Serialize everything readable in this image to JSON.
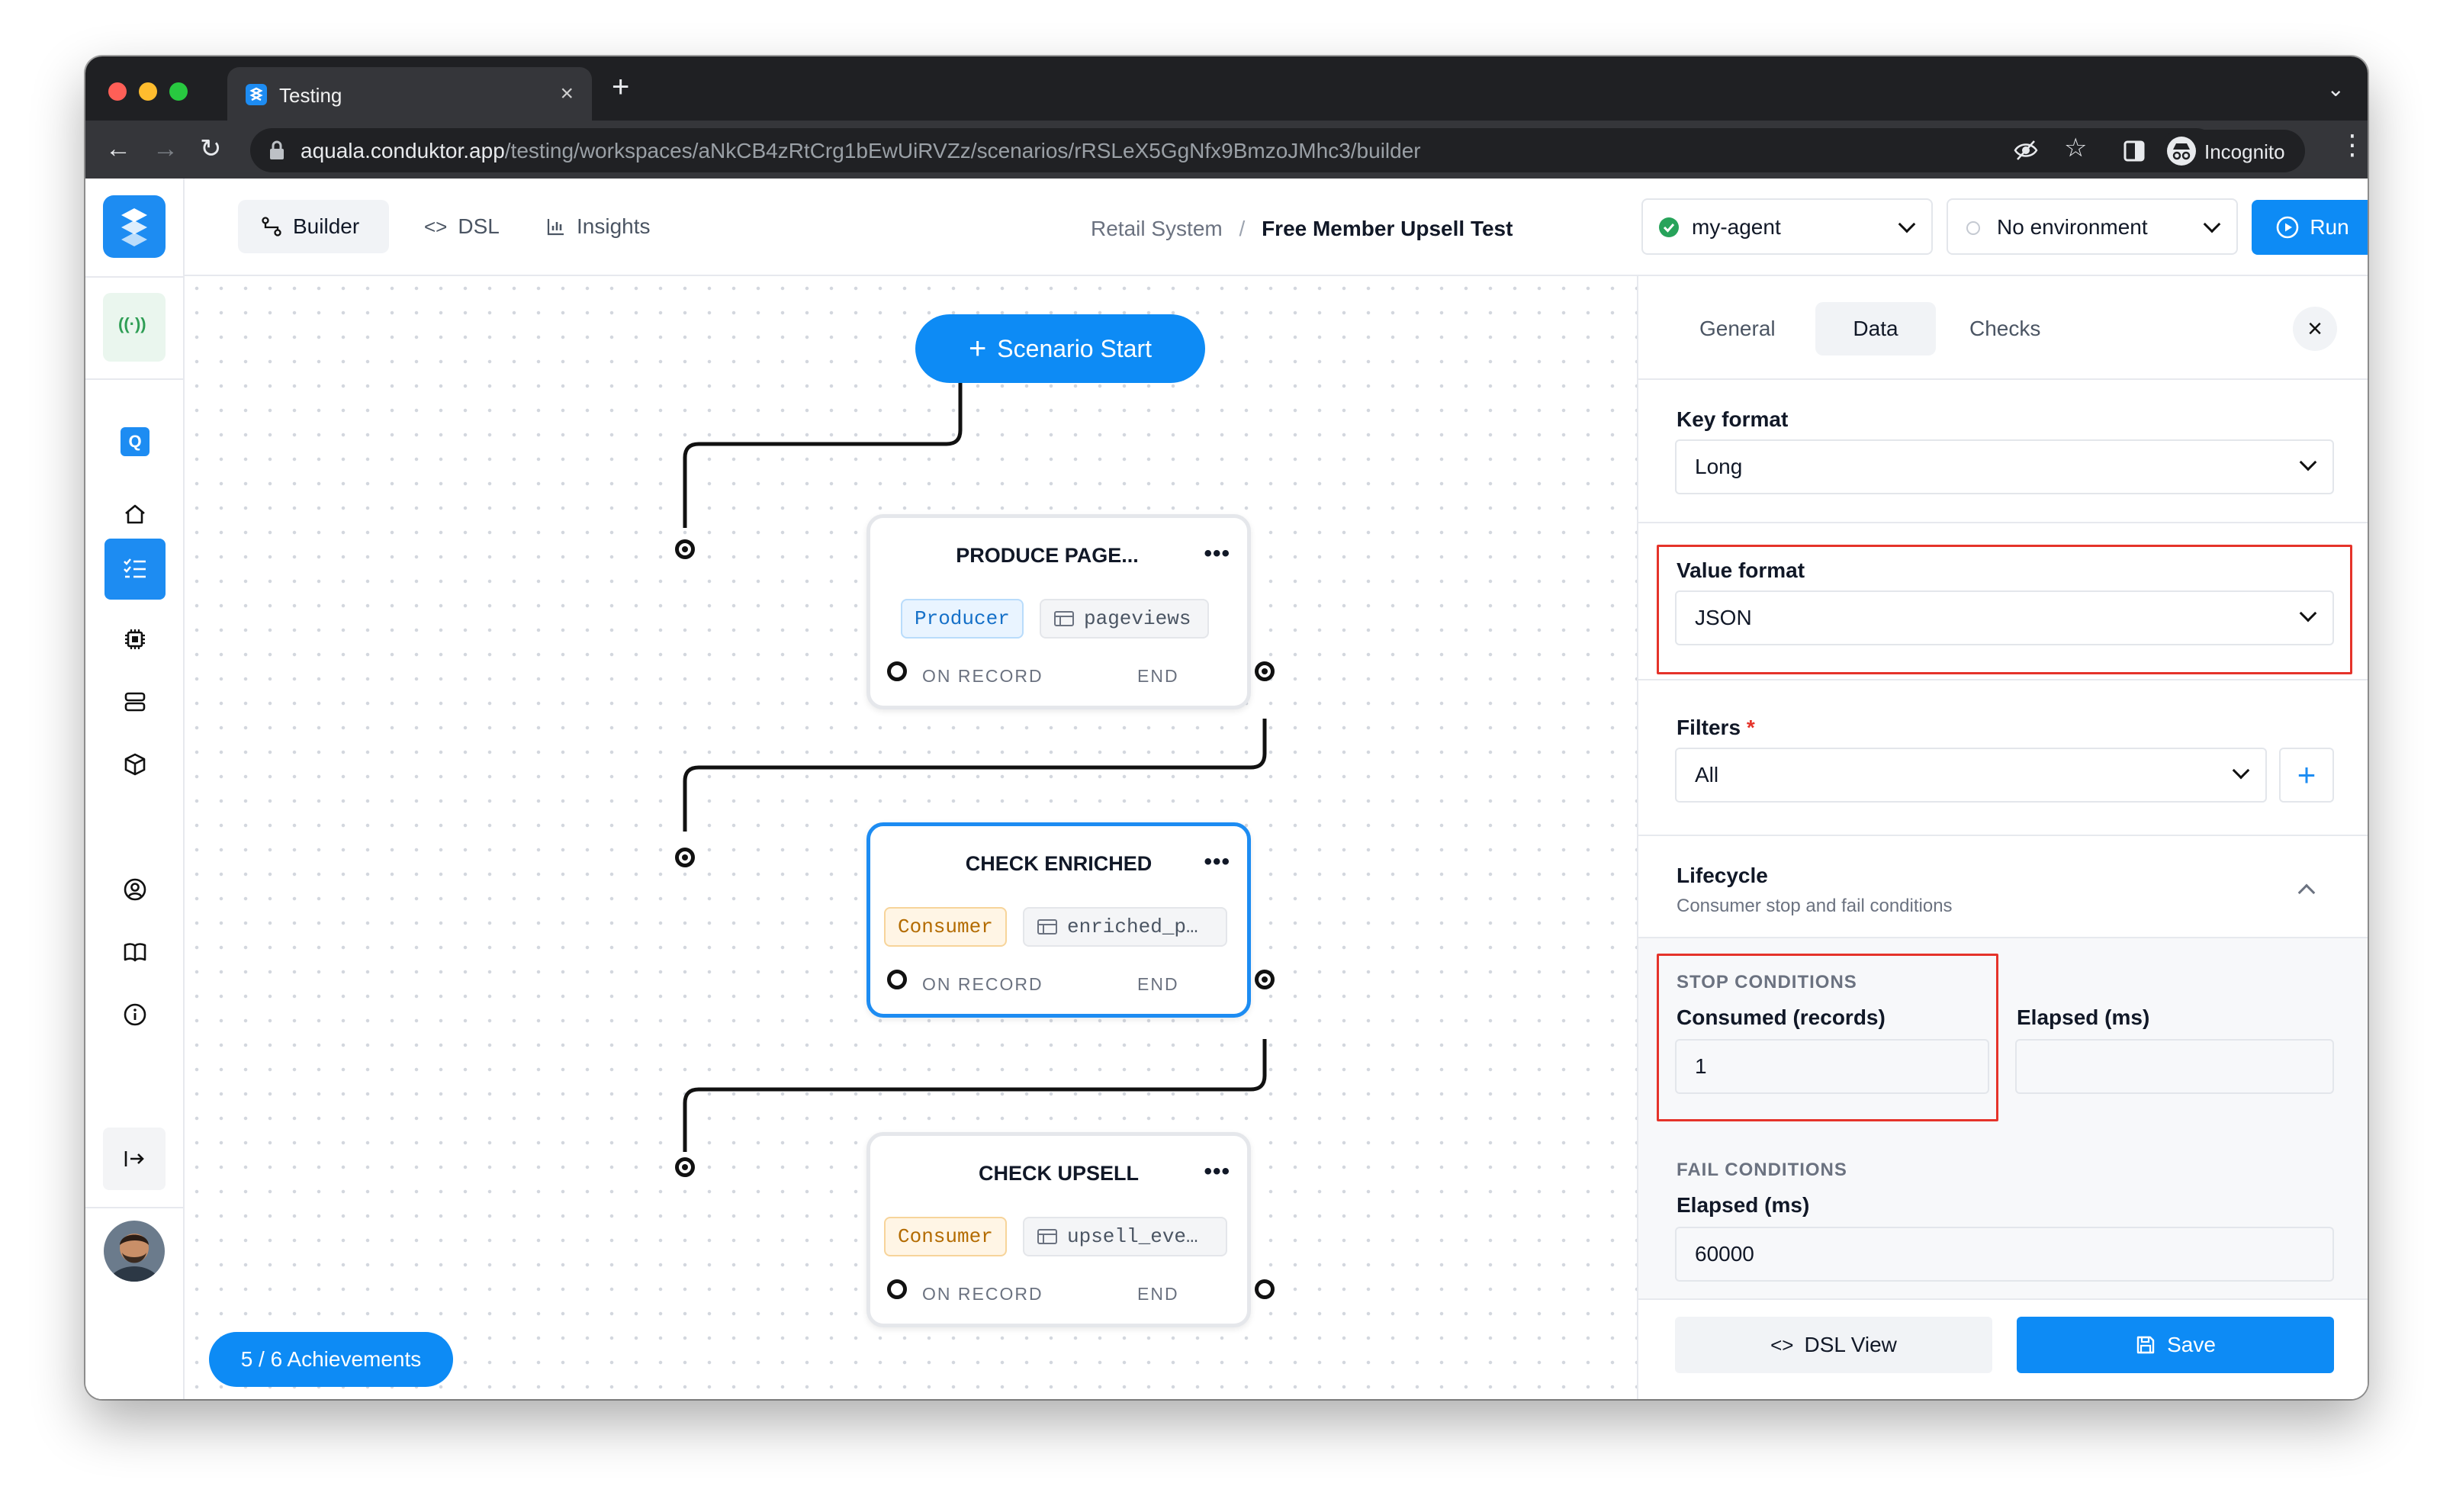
{
  "browser": {
    "tab_title": "Testing",
    "new_tab": "+",
    "url_host": "aquala.conduktor.app",
    "url_path": "/testing/workspaces/aNkCB4zRtCrg1bEwUiRVZz/scenarios/rRSLeX5GgNfx9BmzoJMhc3/builder",
    "profile_label": "Incognito"
  },
  "toolbar": {
    "tabs": [
      {
        "label": "Builder",
        "active": true
      },
      {
        "label": "DSL",
        "active": false
      },
      {
        "label": "Insights",
        "active": false
      }
    ],
    "breadcrumb_parent": "Retail System",
    "breadcrumb_sep": "/",
    "breadcrumb_current": "Free Member Upsell Test",
    "agent": "my-agent",
    "environment": "No environment",
    "run_label": "Run"
  },
  "sidebar": {
    "items": [
      {
        "icon": "broadcast-icon"
      },
      {
        "icon": "q-badge-icon",
        "label": "Q"
      },
      {
        "icon": "home-icon"
      },
      {
        "icon": "checklist-icon",
        "active": true
      },
      {
        "icon": "chip-icon"
      },
      {
        "icon": "server-icon"
      },
      {
        "icon": "cube-icon"
      },
      {
        "icon": "user-circle-icon"
      },
      {
        "icon": "book-icon"
      },
      {
        "icon": "info-icon"
      },
      {
        "icon": "collapse-icon"
      }
    ]
  },
  "canvas": {
    "start_label": "Scenario Start",
    "achievements": "5 / 6 Achievements",
    "nodes": [
      {
        "title": "PRODUCE PAGE...",
        "kind": "Producer",
        "topic": "pageviews",
        "on_record": "ON RECORD",
        "end": "END"
      },
      {
        "title": "CHECK ENRICHED",
        "kind": "Consumer",
        "topic": "enriched_p…",
        "on_record": "ON RECORD",
        "end": "END",
        "selected": true
      },
      {
        "title": "CHECK UPSELL",
        "kind": "Consumer",
        "topic": "upsell_eve…",
        "on_record": "ON RECORD",
        "end": "END"
      }
    ]
  },
  "panel": {
    "tabs": [
      {
        "label": "General",
        "active": false
      },
      {
        "label": "Data",
        "active": true
      },
      {
        "label": "Checks",
        "active": false
      }
    ],
    "key_format_label": "Key format",
    "key_format_value": "Long",
    "value_format_label": "Value format",
    "value_format_value": "JSON",
    "filters_label": "Filters",
    "filters_required": "*",
    "filters_value": "All",
    "lifecycle_title": "Lifecycle",
    "lifecycle_subtitle": "Consumer stop and fail conditions",
    "stop_conditions": "STOP CONDITIONS",
    "consumed_label": "Consumed (records)",
    "consumed_value": "1",
    "elapsed_label": "Elapsed (ms)",
    "elapsed_value": "",
    "fail_conditions": "FAIL CONDITIONS",
    "fail_elapsed_label": "Elapsed (ms)",
    "fail_elapsed_value": "60000",
    "dsl_view_label": "DSL View",
    "save_label": "Save"
  },
  "colors": {
    "accent": "#0d8bf5",
    "highlight_box": "#e5332a",
    "producer_text": "#1570c8",
    "consumer_text": "#b36b00"
  }
}
